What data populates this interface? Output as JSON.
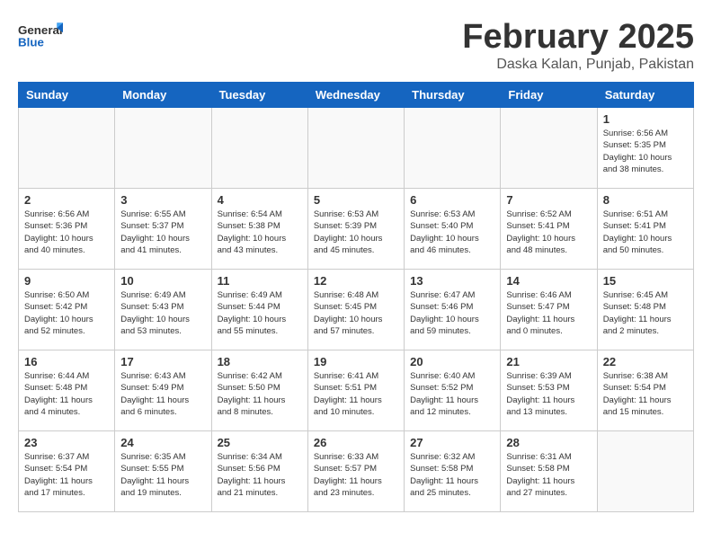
{
  "header": {
    "logo_general": "General",
    "logo_blue": "Blue",
    "month_title": "February 2025",
    "location": "Daska Kalan, Punjab, Pakistan"
  },
  "days_of_week": [
    "Sunday",
    "Monday",
    "Tuesday",
    "Wednesday",
    "Thursday",
    "Friday",
    "Saturday"
  ],
  "weeks": [
    [
      {
        "day": "",
        "info": ""
      },
      {
        "day": "",
        "info": ""
      },
      {
        "day": "",
        "info": ""
      },
      {
        "day": "",
        "info": ""
      },
      {
        "day": "",
        "info": ""
      },
      {
        "day": "",
        "info": ""
      },
      {
        "day": "1",
        "info": "Sunrise: 6:56 AM\nSunset: 5:35 PM\nDaylight: 10 hours\nand 38 minutes."
      }
    ],
    [
      {
        "day": "2",
        "info": "Sunrise: 6:56 AM\nSunset: 5:36 PM\nDaylight: 10 hours\nand 40 minutes."
      },
      {
        "day": "3",
        "info": "Sunrise: 6:55 AM\nSunset: 5:37 PM\nDaylight: 10 hours\nand 41 minutes."
      },
      {
        "day": "4",
        "info": "Sunrise: 6:54 AM\nSunset: 5:38 PM\nDaylight: 10 hours\nand 43 minutes."
      },
      {
        "day": "5",
        "info": "Sunrise: 6:53 AM\nSunset: 5:39 PM\nDaylight: 10 hours\nand 45 minutes."
      },
      {
        "day": "6",
        "info": "Sunrise: 6:53 AM\nSunset: 5:40 PM\nDaylight: 10 hours\nand 46 minutes."
      },
      {
        "day": "7",
        "info": "Sunrise: 6:52 AM\nSunset: 5:41 PM\nDaylight: 10 hours\nand 48 minutes."
      },
      {
        "day": "8",
        "info": "Sunrise: 6:51 AM\nSunset: 5:41 PM\nDaylight: 10 hours\nand 50 minutes."
      }
    ],
    [
      {
        "day": "9",
        "info": "Sunrise: 6:50 AM\nSunset: 5:42 PM\nDaylight: 10 hours\nand 52 minutes."
      },
      {
        "day": "10",
        "info": "Sunrise: 6:49 AM\nSunset: 5:43 PM\nDaylight: 10 hours\nand 53 minutes."
      },
      {
        "day": "11",
        "info": "Sunrise: 6:49 AM\nSunset: 5:44 PM\nDaylight: 10 hours\nand 55 minutes."
      },
      {
        "day": "12",
        "info": "Sunrise: 6:48 AM\nSunset: 5:45 PM\nDaylight: 10 hours\nand 57 minutes."
      },
      {
        "day": "13",
        "info": "Sunrise: 6:47 AM\nSunset: 5:46 PM\nDaylight: 10 hours\nand 59 minutes."
      },
      {
        "day": "14",
        "info": "Sunrise: 6:46 AM\nSunset: 5:47 PM\nDaylight: 11 hours\nand 0 minutes."
      },
      {
        "day": "15",
        "info": "Sunrise: 6:45 AM\nSunset: 5:48 PM\nDaylight: 11 hours\nand 2 minutes."
      }
    ],
    [
      {
        "day": "16",
        "info": "Sunrise: 6:44 AM\nSunset: 5:48 PM\nDaylight: 11 hours\nand 4 minutes."
      },
      {
        "day": "17",
        "info": "Sunrise: 6:43 AM\nSunset: 5:49 PM\nDaylight: 11 hours\nand 6 minutes."
      },
      {
        "day": "18",
        "info": "Sunrise: 6:42 AM\nSunset: 5:50 PM\nDaylight: 11 hours\nand 8 minutes."
      },
      {
        "day": "19",
        "info": "Sunrise: 6:41 AM\nSunset: 5:51 PM\nDaylight: 11 hours\nand 10 minutes."
      },
      {
        "day": "20",
        "info": "Sunrise: 6:40 AM\nSunset: 5:52 PM\nDaylight: 11 hours\nand 12 minutes."
      },
      {
        "day": "21",
        "info": "Sunrise: 6:39 AM\nSunset: 5:53 PM\nDaylight: 11 hours\nand 13 minutes."
      },
      {
        "day": "22",
        "info": "Sunrise: 6:38 AM\nSunset: 5:54 PM\nDaylight: 11 hours\nand 15 minutes."
      }
    ],
    [
      {
        "day": "23",
        "info": "Sunrise: 6:37 AM\nSunset: 5:54 PM\nDaylight: 11 hours\nand 17 minutes."
      },
      {
        "day": "24",
        "info": "Sunrise: 6:35 AM\nSunset: 5:55 PM\nDaylight: 11 hours\nand 19 minutes."
      },
      {
        "day": "25",
        "info": "Sunrise: 6:34 AM\nSunset: 5:56 PM\nDaylight: 11 hours\nand 21 minutes."
      },
      {
        "day": "26",
        "info": "Sunrise: 6:33 AM\nSunset: 5:57 PM\nDaylight: 11 hours\nand 23 minutes."
      },
      {
        "day": "27",
        "info": "Sunrise: 6:32 AM\nSunset: 5:58 PM\nDaylight: 11 hours\nand 25 minutes."
      },
      {
        "day": "28",
        "info": "Sunrise: 6:31 AM\nSunset: 5:58 PM\nDaylight: 11 hours\nand 27 minutes."
      },
      {
        "day": "",
        "info": ""
      }
    ]
  ]
}
